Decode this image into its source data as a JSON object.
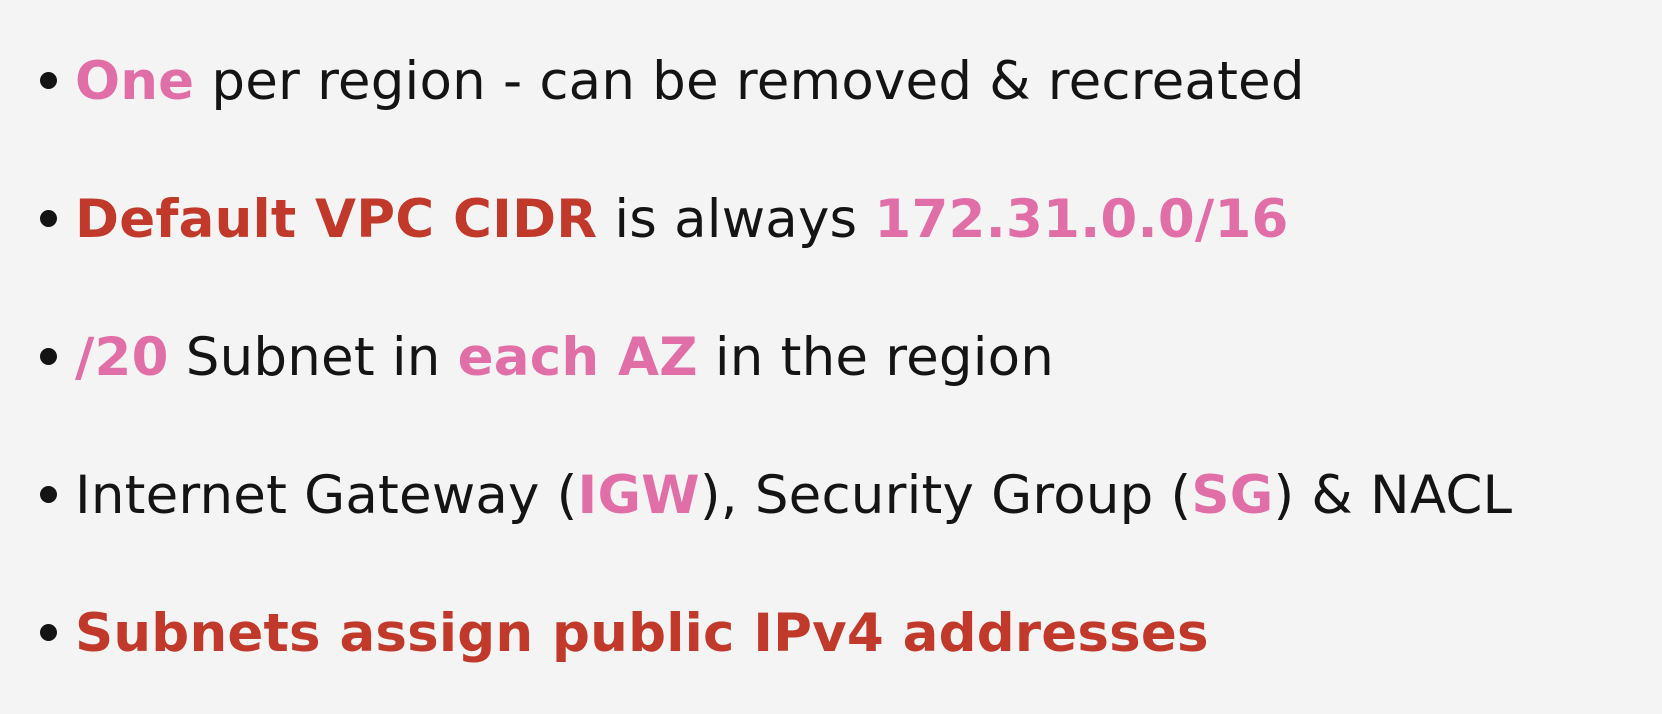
{
  "colors": {
    "background": "#f5f4f4",
    "text": "#141414",
    "pink_highlight": "#e06fa8",
    "red_highlight": "#c0392b"
  },
  "bullets": [
    {
      "segments": [
        {
          "text": "One",
          "style": "pink"
        },
        {
          "text": " per region - can be removed & recreated",
          "style": "normal"
        }
      ]
    },
    {
      "segments": [
        {
          "text": "Default VPC CIDR",
          "style": "red"
        },
        {
          "text": " is always ",
          "style": "normal"
        },
        {
          "text": "172.31.0.0/16",
          "style": "pink"
        }
      ]
    },
    {
      "segments": [
        {
          "text": "/20",
          "style": "pink"
        },
        {
          "text": " Subnet in ",
          "style": "normal"
        },
        {
          "text": "each AZ",
          "style": "pink"
        },
        {
          "text": " in the region",
          "style": "normal"
        }
      ]
    },
    {
      "segments": [
        {
          "text": "Internet Gateway (",
          "style": "normal"
        },
        {
          "text": "IGW",
          "style": "pink"
        },
        {
          "text": "), Security Group (",
          "style": "normal"
        },
        {
          "text": "SG",
          "style": "pink"
        },
        {
          "text": ") & NACL",
          "style": "normal"
        }
      ]
    },
    {
      "segments": [
        {
          "text": "Subnets assign public IPv4 addresses",
          "style": "red"
        }
      ]
    }
  ]
}
